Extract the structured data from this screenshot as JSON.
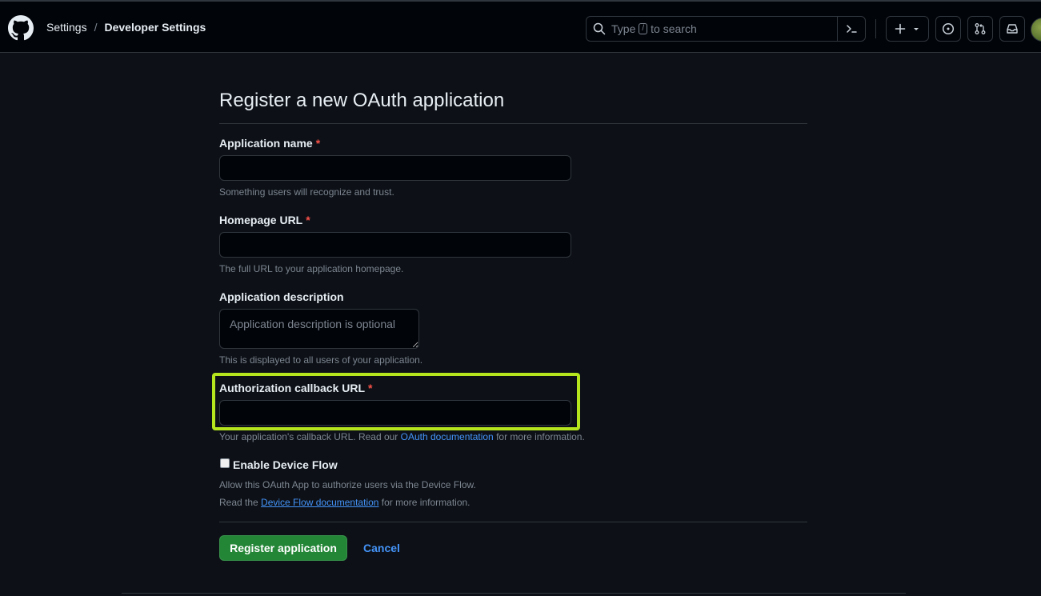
{
  "header": {
    "breadcrumb": [
      "Settings",
      "Developer Settings"
    ],
    "separator": "/",
    "search": {
      "prefix": "Type",
      "key": "/",
      "suffix": "to search"
    },
    "icons": [
      "github-logo",
      "search-icon",
      "command-palette-icon",
      "plus-icon",
      "chevron-down-icon",
      "issues-icon",
      "pull-requests-icon",
      "inbox-icon",
      "avatar"
    ]
  },
  "form": {
    "title": "Register a new OAuth application",
    "required_marker": "*",
    "app_name": {
      "label": "Application name",
      "value": "",
      "hint": "Something users will recognize and trust."
    },
    "homepage_url": {
      "label": "Homepage URL",
      "value": "",
      "hint": "The full URL to your application homepage."
    },
    "description": {
      "label": "Application description",
      "placeholder": "Application description is optional",
      "hint": "This is displayed to all users of your application."
    },
    "callback_url": {
      "label": "Authorization callback URL",
      "value": "",
      "hint_prefix": "Your application's callback URL. Read our",
      "hint_link": "OAuth documentation",
      "hint_suffix": "for more information."
    },
    "device_flow": {
      "label": "Enable Device Flow",
      "checked": false,
      "hint_line1": "Allow this OAuth App to authorize users via the Device Flow.",
      "hint_line2_prefix": "Read the",
      "hint_line2_link": "Device Flow documentation",
      "hint_line2_suffix": "for more information."
    },
    "submit_label": "Register application",
    "cancel_label": "Cancel"
  },
  "colors": {
    "background": "#0d1117",
    "header": "#010409",
    "primary_button": "#238636",
    "link": "#4493f8",
    "required": "#f85149",
    "highlight": "#b5e61d"
  }
}
